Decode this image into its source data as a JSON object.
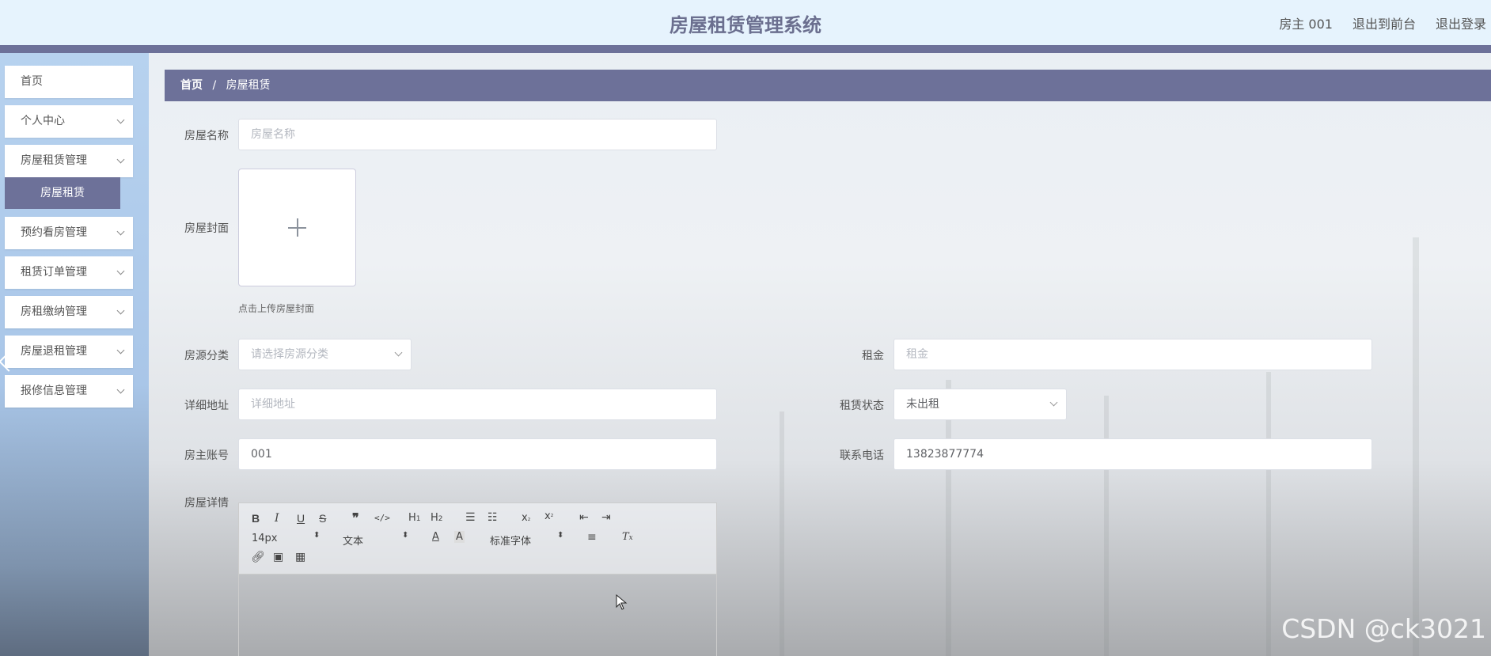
{
  "header": {
    "title": "房屋租赁管理系统",
    "user": "房主 001",
    "to_front": "退出到前台",
    "logout": "退出登录"
  },
  "sidebar": {
    "items": [
      {
        "label": "首页"
      },
      {
        "label": "个人中心"
      },
      {
        "label": "房屋租赁管理"
      },
      {
        "label": "预约看房管理"
      },
      {
        "label": "租赁订单管理"
      },
      {
        "label": "房租缴纳管理"
      },
      {
        "label": "房屋退租管理"
      },
      {
        "label": "报修信息管理"
      }
    ],
    "sub_item": "房屋租赁"
  },
  "breadcrumb": {
    "home": "首页",
    "sep": "/",
    "current": "房屋租赁"
  },
  "form": {
    "name_label": "房屋名称",
    "name_placeholder": "房屋名称",
    "cover_label": "房屋封面",
    "cover_hint": "点击上传房屋封面",
    "type_label": "房源分类",
    "type_placeholder": "请选择房源分类",
    "rent_label": "租金",
    "rent_placeholder": "租金",
    "address_label": "详细地址",
    "address_placeholder": "详细地址",
    "status_label": "租赁状态",
    "status_value": "未出租",
    "owner_label": "房主账号",
    "owner_value": "001",
    "phone_label": "联系电话",
    "phone_value": "13823877774",
    "detail_label": "房屋详情"
  },
  "editor": {
    "size": "14px",
    "block": "文本",
    "font": "标准字体"
  },
  "watermark": "CSDN @ck3021"
}
